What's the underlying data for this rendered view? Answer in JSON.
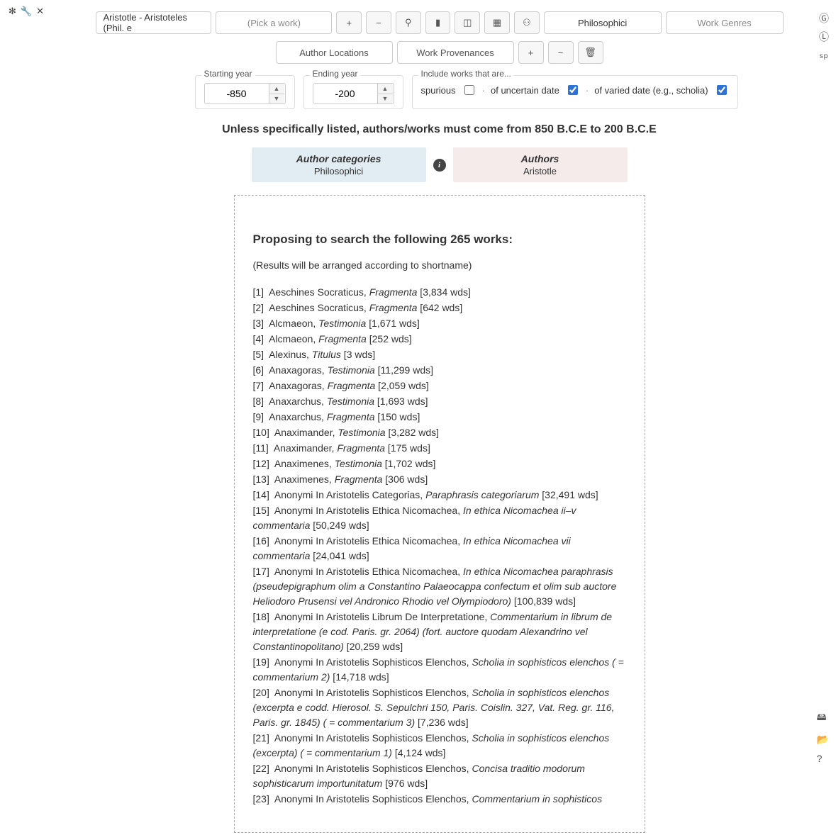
{
  "toolbar": {
    "author_value": "Aristotle - Aristoteles (Phil. e",
    "work_placeholder": "(Pick a work)",
    "category_label": "Philosophici",
    "genres_label": "Work Genres",
    "author_locations": "Author Locations",
    "work_provenances": "Work Provenances"
  },
  "icons": {
    "plus": "+",
    "minus": "−",
    "pin": "⚲",
    "col1": "▮",
    "col2": "◫",
    "col3": "▦",
    "person": "⚇",
    "trash": "🗑",
    "gear": "✻",
    "wrench": "🔧",
    "close": "✕",
    "g": "Ⓖ",
    "l": "Ⓛ",
    "sp": "sp",
    "save": "🖴",
    "folder": "📂",
    "help": "?"
  },
  "filters": {
    "start_legend": "Starting year",
    "end_legend": "Ending year",
    "start_value": "-850",
    "end_value": "-200",
    "include_legend": "Include works that are...",
    "opt_spurious": "spurious",
    "opt_uncertain": "of uncertain date",
    "opt_varied": "of varied date (e.g., scholia)",
    "spurious_checked": false,
    "uncertain_checked": true,
    "varied_checked": true
  },
  "banner": "Unless specifically listed, authors/works must come from 850 B.C.E to 200 B.C.E",
  "tags": {
    "cat_title": "Author categories",
    "cat_value": "Philosophici",
    "auth_title": "Authors",
    "auth_value": "Aristotle"
  },
  "results": {
    "heading": "Proposing to search the following 265 works:",
    "note": "(Results will be arranged according to shortname)",
    "items": [
      {
        "n": 1,
        "author": "Aeschines Socraticus",
        "title": "Fragmenta",
        "wds": "3,834 wds"
      },
      {
        "n": 2,
        "author": "Aeschines Socraticus",
        "title": "Fragmenta",
        "wds": "642 wds"
      },
      {
        "n": 3,
        "author": "Alcmaeon",
        "title": "Testimonia",
        "wds": "1,671 wds"
      },
      {
        "n": 4,
        "author": "Alcmaeon",
        "title": "Fragmenta",
        "wds": "252 wds"
      },
      {
        "n": 5,
        "author": "Alexinus",
        "title": "Titulus",
        "wds": "3 wds"
      },
      {
        "n": 6,
        "author": "Anaxagoras",
        "title": "Testimonia",
        "wds": "11,299 wds"
      },
      {
        "n": 7,
        "author": "Anaxagoras",
        "title": "Fragmenta",
        "wds": "2,059 wds"
      },
      {
        "n": 8,
        "author": "Anaxarchus",
        "title": "Testimonia",
        "wds": "1,693 wds"
      },
      {
        "n": 9,
        "author": "Anaxarchus",
        "title": "Fragmenta",
        "wds": "150 wds"
      },
      {
        "n": 10,
        "author": "Anaximander",
        "title": "Testimonia",
        "wds": "3,282 wds"
      },
      {
        "n": 11,
        "author": "Anaximander",
        "title": "Fragmenta",
        "wds": "175 wds"
      },
      {
        "n": 12,
        "author": "Anaximenes",
        "title": "Testimonia",
        "wds": "1,702 wds"
      },
      {
        "n": 13,
        "author": "Anaximenes",
        "title": "Fragmenta",
        "wds": "306 wds"
      },
      {
        "n": 14,
        "author": "Anonymi In Aristotelis Categorias",
        "title": "Paraphrasis categoriarum",
        "wds": "32,491 wds"
      },
      {
        "n": 15,
        "author": "Anonymi In Aristotelis Ethica Nicomachea",
        "title": "In ethica Nicomachea ii–v commentaria",
        "wds": "50,249 wds"
      },
      {
        "n": 16,
        "author": "Anonymi In Aristotelis Ethica Nicomachea",
        "title": "In ethica Nicomachea vii commentaria",
        "wds": "24,041 wds"
      },
      {
        "n": 17,
        "author": "Anonymi In Aristotelis Ethica Nicomachea",
        "title": "In ethica Nicomachea paraphrasis (pseudepigraphum olim a Constantino Palaeocappa confectum et olim sub auctore Heliodoro Prusensi vel Andronico Rhodio vel Olympiodoro)",
        "wds": "100,839 wds"
      },
      {
        "n": 18,
        "author": "Anonymi In Aristotelis Librum De Interpretatione",
        "title": "Commentarium in librum de interpretatione (e cod. Paris. gr. 2064) (fort. auctore quodam Alexandrino vel Constantinopolitano)",
        "wds": "20,259 wds"
      },
      {
        "n": 19,
        "author": "Anonymi In Aristotelis Sophisticos Elenchos",
        "title": "Scholia in sophisticos elenchos ( = commentarium 2)",
        "wds": "14,718 wds"
      },
      {
        "n": 20,
        "author": "Anonymi In Aristotelis Sophisticos Elenchos",
        "title": "Scholia in sophisticos elenchos (excerpta e codd. Hierosol. S. Sepulchri 150, Paris. Coislin. 327, Vat. Reg. gr. 116, Paris. gr. 1845) ( = commentarium 3)",
        "wds": "7,236 wds"
      },
      {
        "n": 21,
        "author": "Anonymi In Aristotelis Sophisticos Elenchos",
        "title": "Scholia in sophisticos elenchos (excerpta) ( = commentarium 1)",
        "wds": "4,124 wds"
      },
      {
        "n": 22,
        "author": "Anonymi In Aristotelis Sophisticos Elenchos",
        "title": "Concisa traditio modorum sophisticarum importunitatum",
        "wds": "976 wds"
      },
      {
        "n": 23,
        "author": "Anonymi In Aristotelis Sophisticos Elenchos",
        "title": "Commentarium in sophisticos",
        "wds": ""
      }
    ]
  }
}
